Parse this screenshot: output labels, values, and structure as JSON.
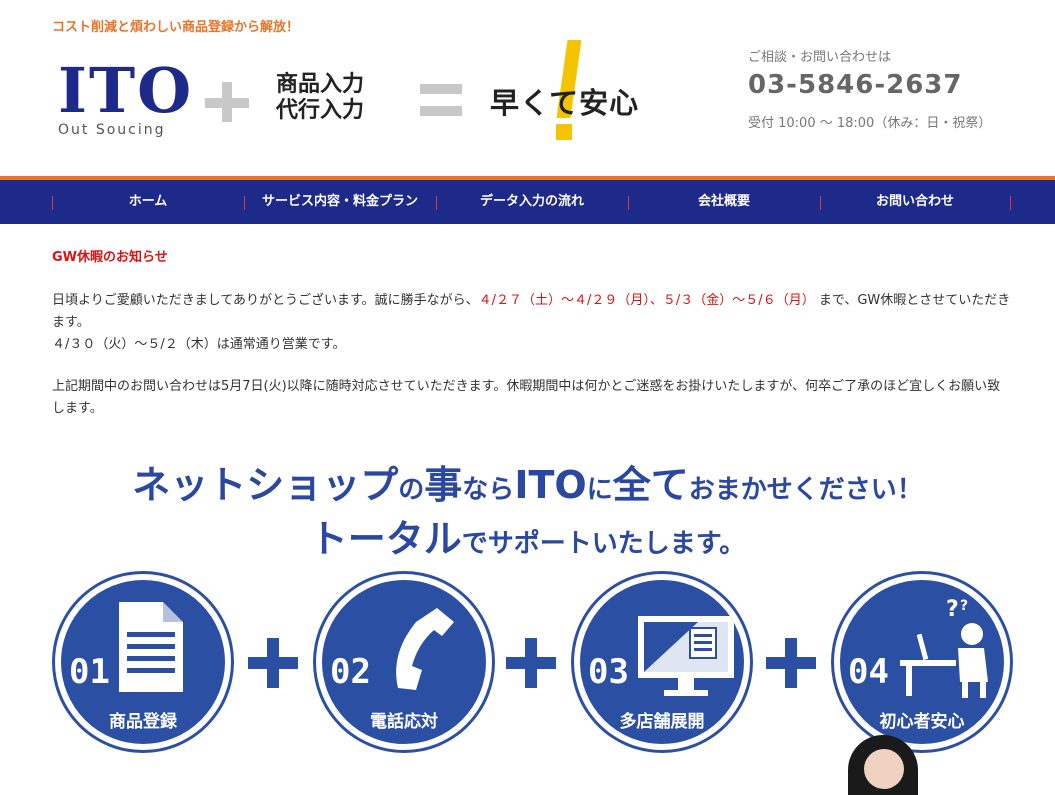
{
  "header": {
    "tagline": "コスト削減と煩わしい商品登録から解放！",
    "logo_main": "ITO",
    "logo_sub": "Out Soucing",
    "service_line1": "商品入力",
    "service_line2": "代行入力",
    "slogan": "早くて安心",
    "contact_label": "ご相談・お問い合わせは",
    "contact_phone": "03-5846-2637",
    "contact_hours": "受付 10:00 ～ 18:00（休み：日・祝祭）"
  },
  "nav": {
    "items": [
      {
        "label": "ホーム"
      },
      {
        "label": "サービス内容・料金プラン"
      },
      {
        "label": "データ入力の流れ"
      },
      {
        "label": "会社概要"
      },
      {
        "label": "お問い合わせ"
      }
    ]
  },
  "news": {
    "title": "GW休暇のお知らせ",
    "p1_before": "日頃よりご愛顧いただきましてありがとうございます。誠に勝手ながら、",
    "p1_dates": "４/２７（土）～４/２９（月）、５/３（金）～５/６（月）",
    "p1_after": " まで、GW休暇とさせていただきます。",
    "p2": "４/３０（火）～５/２（木）は通常通り営業です。",
    "p3": "上記期間中のお問い合わせは5月7日(火)以降に随時対応させていただきます。休暇期間中は何かとご迷惑をお掛けいたしますが、何卒ご了承のほど宜しくお願い致します。"
  },
  "heading": {
    "l1_a": "ネットショップ",
    "l1_b": "の",
    "l1_c": "事",
    "l1_d": "なら",
    "l1_e": "ITO",
    "l1_f": "に",
    "l1_g": "全て",
    "l1_h": "おまかせください！",
    "l2_a": "トータル",
    "l2_b": "でサポートいたします。"
  },
  "services": [
    {
      "num": "01",
      "label": "商品登録",
      "icon": "document-icon"
    },
    {
      "num": "02",
      "label": "電話応対",
      "icon": "phone-icon"
    },
    {
      "num": "03",
      "label": "多店舗展開",
      "icon": "monitor-icon"
    },
    {
      "num": "04",
      "label": "初心者安心",
      "icon": "person-desk-icon"
    }
  ],
  "colors": {
    "brand_blue": "#1d2a8a",
    "accent_orange": "#e8742a",
    "circle_blue": "#2b4fa2",
    "exclaim_yellow": "#f5c400",
    "notice_red": "#d11111"
  }
}
